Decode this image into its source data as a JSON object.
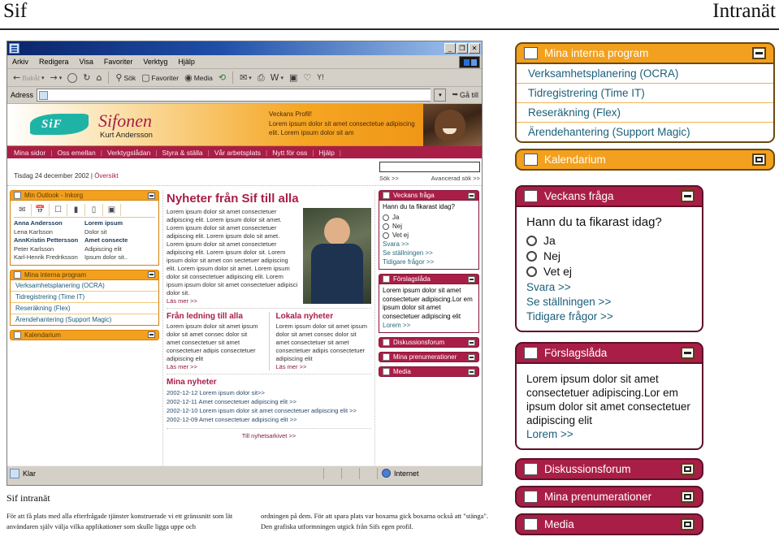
{
  "page": {
    "brand": "Sif",
    "section": "Intranät"
  },
  "browser": {
    "title": "",
    "window_buttons": {
      "minimize": "_",
      "restore": "❐",
      "close": "✕"
    },
    "menu": [
      "Arkiv",
      "Redigera",
      "Visa",
      "Favoriter",
      "Verktyg",
      "Hjälp"
    ],
    "toolbar": [
      {
        "label": "Bakåt",
        "icon": "back-arrow-icon"
      },
      {
        "label": "",
        "icon": "forward-arrow-icon"
      },
      {
        "label": "",
        "icon": "stop-icon"
      },
      {
        "label": "",
        "icon": "refresh-icon"
      },
      {
        "label": "",
        "icon": "home-icon"
      },
      {
        "label": "Sök",
        "icon": "search-icon"
      },
      {
        "label": "Favoriter",
        "icon": "favorites-star-icon"
      },
      {
        "label": "Media",
        "icon": "media-icon"
      },
      {
        "label": "",
        "icon": "history-icon"
      },
      {
        "label": "",
        "icon": "mail-icon"
      },
      {
        "label": "",
        "icon": "print-icon"
      },
      {
        "label": "",
        "icon": "word-icon"
      },
      {
        "label": "",
        "icon": "edit-icon"
      },
      {
        "label": "",
        "icon": "messenger-icon"
      },
      {
        "label": "",
        "icon": "yahoo-icon"
      }
    ],
    "address": {
      "label": "Adress",
      "value": "",
      "placeholder": "",
      "go_label": "Gå till"
    },
    "status": {
      "left": "Klar",
      "zone": "Internet"
    }
  },
  "sif": {
    "banner": {
      "logo_text": "SiF",
      "title": "Sifonen",
      "user": "Kurt Andersson",
      "profile_heading": "Veckans Profil!",
      "profile_text": "Lorem ipsum dolor sit amet consectetue adipiscing elit. Lorem ipsum dolor sit am"
    },
    "nav": [
      "Mina sidor",
      "Oss emellan",
      "Verktygslådan",
      "Styra & ställa",
      "Vår arbetsplats",
      "Nytt för oss",
      "Hjälp"
    ],
    "subbar": {
      "date": "Tisdag 24 december 2002",
      "separator": "|",
      "overview": "Översikt",
      "search_value": "",
      "search_link": "Sök >>",
      "advanced_link": "Avancerad sök >>"
    },
    "outlook": {
      "title": "Min Outlook - Inkorg",
      "tool_icons": [
        "new-mail-icon",
        "new-appointment-icon",
        "new-task-icon",
        "envelope-icon",
        "note-icon",
        "contact-card-icon"
      ],
      "messages": [
        {
          "sender": "Anna  Andersson",
          "subject": "Lorem ipsum",
          "unread": true
        },
        {
          "sender": "Lena  Karlsson",
          "subject": "Dolor sit",
          "unread": false
        },
        {
          "sender": "AnnKristin  Pettersson",
          "subject": "Amet consecte",
          "unread": true
        },
        {
          "sender": "Peter Karlsson",
          "subject": "Adipiscing elit",
          "unread": false
        },
        {
          "sender": "Karl-Henrik  Fredriksson",
          "subject": "Ipsum dolor sit..",
          "unread": false
        }
      ]
    },
    "programs_panel": {
      "title": "Mina interna program"
    },
    "programs": [
      "Verksamhetsplanering (OCRA)",
      "Tidregistrering (Time IT)",
      "Reseräkning (Flex)",
      "Ärendehantering (Support Magic)"
    ],
    "calendar_panel": {
      "title": "Kalendarium"
    },
    "news_main": {
      "heading": "Nyheter från Sif till alla",
      "body": "Lorem ipsum dolor sit amet consectetuer adipiscing elit. Lorem ipsum dolor sit amet. Lorem ipsum dolor sit amet consectetuer adipiscing elit. Lorem ipsum dolo sit amet. Lorem ipsum dolor sit amet consectetuer adipiscing elit. Lorem ipsum dolor sit. Lorem ipsum dolor sit amet con sectetuer adipiscing elit. Lorem ipsum dolor sit amet. Lorem ipsum dolor sit consectetuer adipiscing elit. Lorem ipsum ipsum dolor sit amet consectetuer adipisci dolor sit.",
      "more": "Läs mer >>"
    },
    "news_left": {
      "heading": "Från ledning till alla",
      "body": "Lorem ipsum dolor sit amet ipsum dolor sit amet consec dolor sit amet consectetuer sit amet consectetuer adipis consectetuer adipiscing elit",
      "more": "Läs mer >>"
    },
    "news_right": {
      "heading": "Lokala nyheter",
      "body": "Lorem ipsum dolor sit amet ipsum dolor sit amet consec dolor sit amet consectetuer sit amet consectetuer adipis consectetuer adipiscing elit",
      "more": "Läs mer >>"
    },
    "my_news": {
      "heading": "Mina nyheter",
      "items": [
        "2002-12-12 Lorem ipsum dolor sit>>",
        "2002-12-11 Amet consectetuer adipiscing elit >>",
        "2002-12-10 Lorem ipsum dolor sit  amet consectetuer adipiscing elit >>",
        "2002-12-09 Amet consectetuer adipiscing elit >>"
      ],
      "archive": "Till nyhetsarkivet >>"
    }
  },
  "poll": {
    "title": "Veckans fråga",
    "question": "Hann du ta fikarast idag?",
    "options": [
      "Ja",
      "Nej",
      "Vet ej"
    ],
    "links": [
      "Svara >>",
      "Se ställningen >>",
      "Tidigare frågor >>"
    ]
  },
  "suggestion": {
    "title": "Förslagslåda",
    "text": "Lorem ipsum dolor sit amet consectetuer adipiscing.Lor em ipsum dolor sit amet consectetuer adipiscing elit",
    "link": "Lorem >>"
  },
  "collapsed_panels": [
    {
      "title": "Diskussionsforum",
      "icon": "discussion-bubbles-icon"
    },
    {
      "title": "Mina prenumerationer",
      "icon": "subscription-icon"
    },
    {
      "title": "Media",
      "icon": "media-tv-icon"
    }
  ],
  "callouts": {
    "programs": {
      "title": "Mina interna program",
      "icon": "window-list-icon"
    },
    "calendar": {
      "title": "Kalendarium",
      "icon": "calendar-icon"
    },
    "poll": {
      "title": "Veckans fråga",
      "icon": "question-doc-icon"
    },
    "suggestion": {
      "title": "Förslagslåda",
      "icon": "lightbulb-icon"
    }
  },
  "caption": {
    "heading": "Sif intranät",
    "col1": "För att få plats med alla efterfrågade tjänster konstruerade vi ett gränssnitt som lät användaren själv välja vilka applikationer som skulle ligga uppe och",
    "col2": "ordningen på dem. För att spara plats var boxarna gick boxarna också att \"stänga\". Den grafiska utformningen utgick från Sifs egen profil."
  },
  "colors": {
    "orange": "#f2a01e",
    "crimson": "#a91e47",
    "teal": "#1fb3a6",
    "link": "#1b5f7a"
  }
}
